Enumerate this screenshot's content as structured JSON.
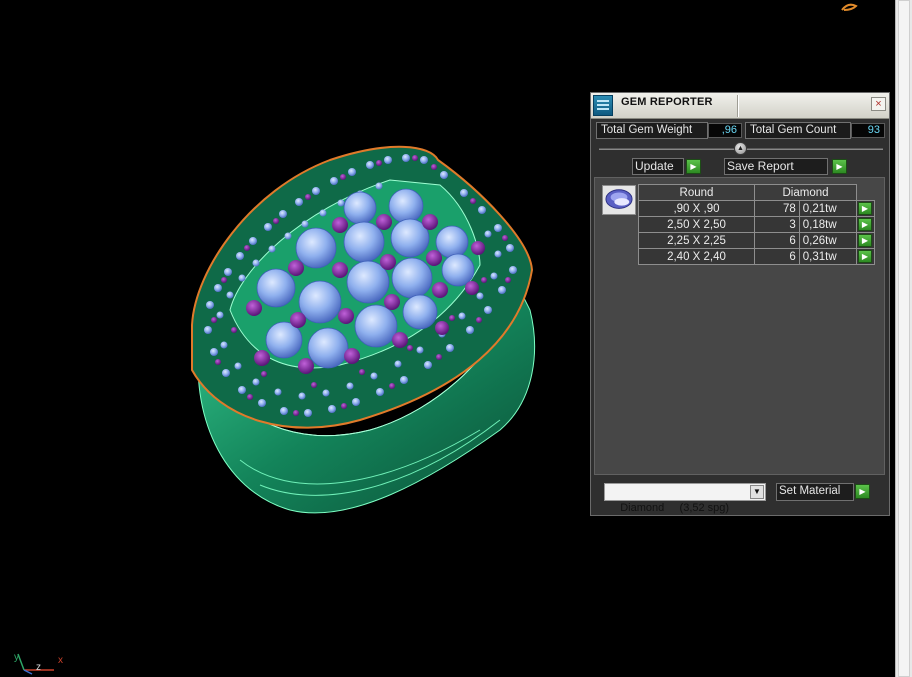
{
  "panel": {
    "title": "GEM REPORTER",
    "close_glyph": "×",
    "total_weight_label": "Total Gem Weight",
    "total_weight_value": ",96",
    "total_count_label": "Total Gem Count",
    "total_count_value": "93",
    "update_label": "Update",
    "save_report_label": "Save Report",
    "table": {
      "shape_header": "Round",
      "material_header": "Diamond",
      "rows": [
        {
          "size": ",90 X ,90",
          "count": "78",
          "weight": "0,21tw"
        },
        {
          "size": "2,50 X 2,50",
          "count": "3",
          "weight": "0,18tw"
        },
        {
          "size": "2,25 X 2,25",
          "count": "6",
          "weight": "0,26tw"
        },
        {
          "size": "2,40 X 2,40",
          "count": "6",
          "weight": "0,31tw"
        }
      ]
    },
    "material_select_value": "Diamond     (3,52 spg)",
    "set_material_label": "Set Material"
  },
  "viewport": {
    "axis_labels": {
      "y": "y",
      "z": "z",
      "x": "x"
    }
  },
  "icons": {
    "panel": "gem-reporter-icon",
    "close": "close-icon",
    "gem": "round-gem-icon",
    "arrow": "play-arrow-icon",
    "dropdown": "chevron-down-icon"
  },
  "colors": {
    "metal": "#1fa36e",
    "large_gem": "#8fb4f0",
    "small_gem": "#7a2aa0",
    "value_text": "#6ad8f5",
    "arrow_button": "#3da832"
  }
}
